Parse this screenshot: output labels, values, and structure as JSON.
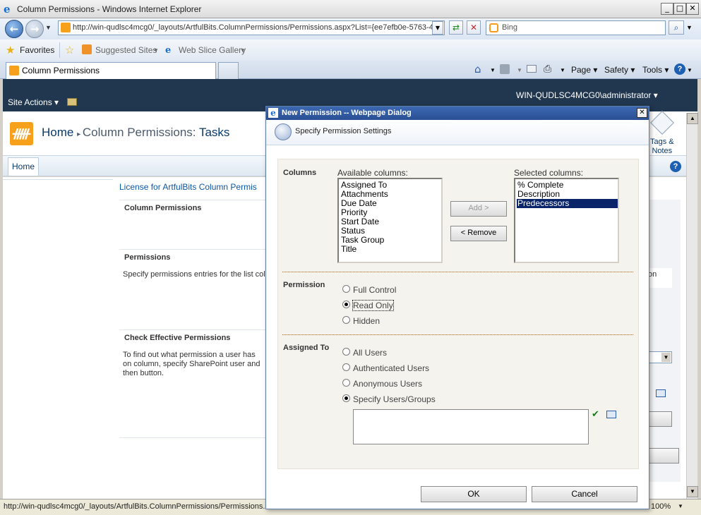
{
  "browser": {
    "window_title": "Column Permissions - Windows Internet Explorer",
    "address": "http://win-qudlsc4mcg0/_layouts/ArtfulBits.ColumnPermissions/Permissions.aspx?List={ee7efb0e-5763-4a",
    "search_placeholder": "Bing",
    "favorites_label": "Favorites",
    "suggested_sites": "Suggested Sites",
    "web_slice": "Web Slice Gallery",
    "tab_title": "Column Permissions",
    "cmd_page": "Page",
    "cmd_safety": "Safety",
    "cmd_tools": "Tools",
    "status_url": "http://win-qudlsc4mcg0/_layouts/ArtfulBits.ColumnPermissions/Permissions.a",
    "zoom": "100%"
  },
  "sharepoint": {
    "user": "WIN-QUDLSC4MCG0\\administrator",
    "site_actions": "Site Actions",
    "breadcrumb_home": "Home",
    "breadcrumb_page": "Column Permissions: ",
    "breadcrumb_list": "Tasks",
    "nav_home": "Home",
    "license_link": "License for ArtfulBits Column Permis",
    "tags_notes": "Tags &\nNotes",
    "sec1_title": "Column Permissions",
    "sec2_title": "Permissions",
    "sec2_text": "Specify permissions entries for the list colu",
    "sec3_title": "Check Effective Permissions",
    "sec3_text": "To find out what permission a user has on column, specify SharePoint user and then button.",
    "right_fragment": "on"
  },
  "dialog": {
    "title": "New Permission -- Webpage Dialog",
    "subtitle": "Specify Permission Settings",
    "columns_label": "Columns",
    "available_label": "Available columns:",
    "selected_label": "Selected columns:",
    "available": [
      "Assigned To",
      "Attachments",
      "Due Date",
      "Priority",
      "Start Date",
      "Status",
      "Task Group",
      "Title"
    ],
    "selected": [
      "% Complete",
      "Description",
      "Predecessors"
    ],
    "add_button": "Add >",
    "remove_button": "< Remove",
    "permission_label": "Permission",
    "perm_full": "Full Control",
    "perm_read": "Read Only",
    "perm_hidden": "Hidden",
    "assigned_label": "Assigned To",
    "assign_all": "All Users",
    "assign_auth": "Authenticated Users",
    "assign_anon": "Anonymous Users",
    "assign_specify": "Specify Users/Groups",
    "ok_button": "OK",
    "cancel_button": "Cancel"
  }
}
